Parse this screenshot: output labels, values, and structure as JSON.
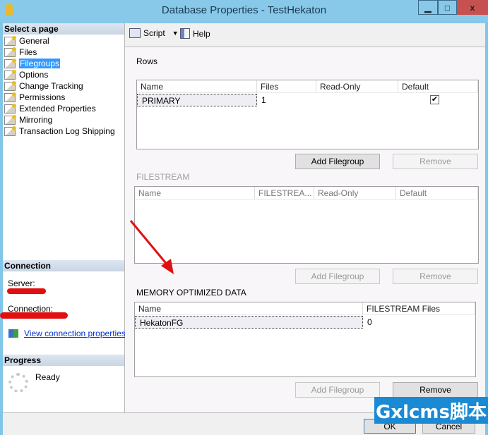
{
  "window": {
    "title": "Database Properties - TestHekaton",
    "minimize": "▁",
    "maximize": "□",
    "close": "x"
  },
  "sidebar": {
    "header": "Select a page",
    "items": [
      {
        "label": "General"
      },
      {
        "label": "Files"
      },
      {
        "label": "Filegroups",
        "selected": true
      },
      {
        "label": "Options"
      },
      {
        "label": "Change Tracking"
      },
      {
        "label": "Permissions"
      },
      {
        "label": "Extended Properties"
      },
      {
        "label": "Mirroring"
      },
      {
        "label": "Transaction Log Shipping"
      }
    ],
    "connection": {
      "header": "Connection",
      "server_label": "Server:",
      "connection_label": "Connection:",
      "view_link": "View connection properties"
    },
    "progress": {
      "header": "Progress",
      "status": "Ready"
    }
  },
  "toolbar": {
    "script": "Script",
    "help": "Help"
  },
  "rows": {
    "label": "Rows",
    "columns": [
      "Name",
      "Files",
      "Read-Only",
      "Default"
    ],
    "data": [
      {
        "name": "PRIMARY",
        "files": "1",
        "read_only": false,
        "default": true
      }
    ],
    "add": "Add Filegroup",
    "remove": "Remove"
  },
  "filestream": {
    "label": "FILESTREAM",
    "columns": [
      "Name",
      "FILESTREA...",
      "Read-Only",
      "Default"
    ],
    "add": "Add Filegroup",
    "remove": "Remove"
  },
  "memory": {
    "label": "MEMORY OPTIMIZED DATA",
    "columns": [
      "Name",
      "FILESTREAM Files"
    ],
    "data": [
      {
        "name": "HekatonFG",
        "files": "0"
      }
    ],
    "add": "Add Filegroup",
    "remove": "Remove"
  },
  "footer": {
    "ok": "OK",
    "cancel": "Cancel"
  },
  "watermark": "Gxlcms脚本",
  "colors": {
    "titlebar": "#88c9ea",
    "selection": "#3399ff",
    "link": "#0033cc",
    "annotation": "#e01010"
  }
}
